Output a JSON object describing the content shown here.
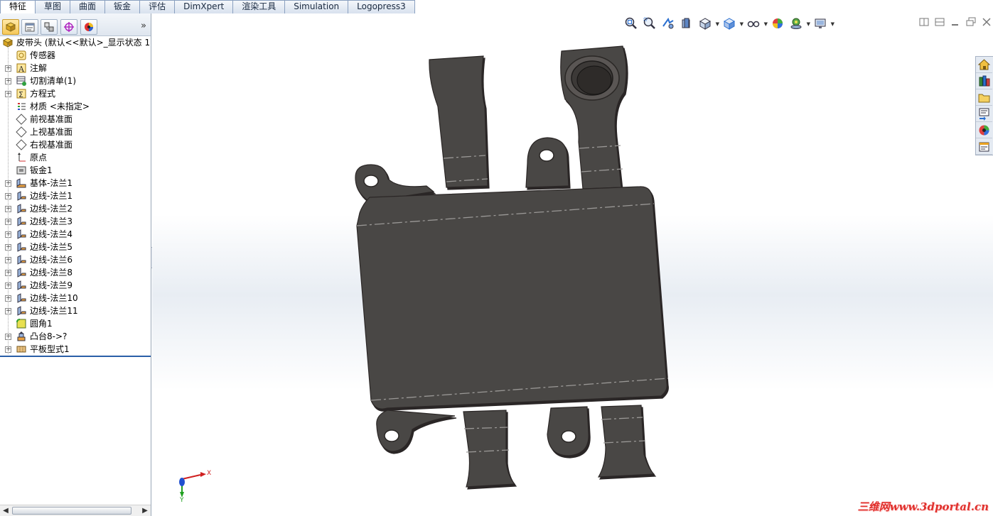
{
  "command_tabs": [
    "特征",
    "草图",
    "曲面",
    "钣金",
    "评估",
    "DimXpert",
    "渲染工具",
    "Simulation",
    "Logopress3"
  ],
  "active_tab": "特征",
  "feature_manager": {
    "tabs": [
      "feature-manager-icon",
      "property-manager-icon",
      "configuration-manager-icon",
      "dimxpert-manager-icon",
      "display-manager-icon"
    ],
    "expand_glyph": "»",
    "root_label": "皮带头  (默认<<默认>_显示状态 1",
    "items": [
      {
        "label": "传感器",
        "icon": "sensor-icon",
        "expandable": false
      },
      {
        "label": "注解",
        "icon": "annotation-icon",
        "expandable": true
      },
      {
        "label": "切割清单(1)",
        "icon": "cut-list-icon",
        "expandable": true
      },
      {
        "label": "方程式",
        "icon": "equation-icon",
        "expandable": true
      },
      {
        "label": "材质 <未指定>",
        "icon": "material-icon",
        "expandable": false
      },
      {
        "label": "前视基准面",
        "icon": "plane-icon",
        "expandable": false
      },
      {
        "label": "上视基准面",
        "icon": "plane-icon",
        "expandable": false
      },
      {
        "label": "右视基准面",
        "icon": "plane-icon",
        "expandable": false
      },
      {
        "label": "原点",
        "icon": "origin-icon",
        "expandable": false
      },
      {
        "label": "钣金1",
        "icon": "sheet-metal-icon",
        "expandable": false
      },
      {
        "label": "基体-法兰1",
        "icon": "base-flange-icon",
        "expandable": true
      },
      {
        "label": "边线-法兰1",
        "icon": "edge-flange-icon",
        "expandable": true
      },
      {
        "label": "边线-法兰2",
        "icon": "edge-flange-icon",
        "expandable": true
      },
      {
        "label": "边线-法兰3",
        "icon": "edge-flange-icon",
        "expandable": true
      },
      {
        "label": "边线-法兰4",
        "icon": "edge-flange-icon",
        "expandable": true
      },
      {
        "label": "边线-法兰5",
        "icon": "edge-flange-icon",
        "expandable": true
      },
      {
        "label": "边线-法兰6",
        "icon": "edge-flange-icon",
        "expandable": true
      },
      {
        "label": "边线-法兰8",
        "icon": "edge-flange-icon",
        "expandable": true
      },
      {
        "label": "边线-法兰9",
        "icon": "edge-flange-icon",
        "expandable": true
      },
      {
        "label": "边线-法兰10",
        "icon": "edge-flange-icon",
        "expandable": true
      },
      {
        "label": "边线-法兰11",
        "icon": "edge-flange-icon",
        "expandable": true
      },
      {
        "label": "圆角1",
        "icon": "fillet-icon",
        "expandable": false
      },
      {
        "label": "凸台8->?",
        "icon": "boss-icon",
        "expandable": true
      },
      {
        "label": "平板型式1",
        "icon": "flat-pattern-icon",
        "expandable": true
      }
    ]
  },
  "heads_up_toolbar": [
    "zoom-to-fit-icon",
    "zoom-to-area-icon",
    "previous-view-icon",
    "section-view-icon",
    "view-orientation-icon",
    "display-style-icon",
    "hide-show-items-icon",
    "edit-appearance-icon",
    "apply-scene-icon",
    "view-settings-icon"
  ],
  "window_controls": [
    "tile-horizontal-icon",
    "tile-vertical-icon",
    "minimize-icon",
    "restore-icon",
    "close-icon"
  ],
  "task_pane": [
    "solidworks-resources-icon",
    "design-library-icon",
    "file-explorer-icon",
    "view-palette-icon",
    "appearances-icon",
    "custom-properties-icon"
  ],
  "triad": {
    "x_label": "X",
    "y_label": "Y"
  },
  "watermark": "三维网www.3dportal.cn",
  "colors": {
    "part": "#4a4644",
    "part_edge": "#2a2725",
    "bend_line": "#9a9896",
    "tab_border": "#8aa0c0"
  }
}
